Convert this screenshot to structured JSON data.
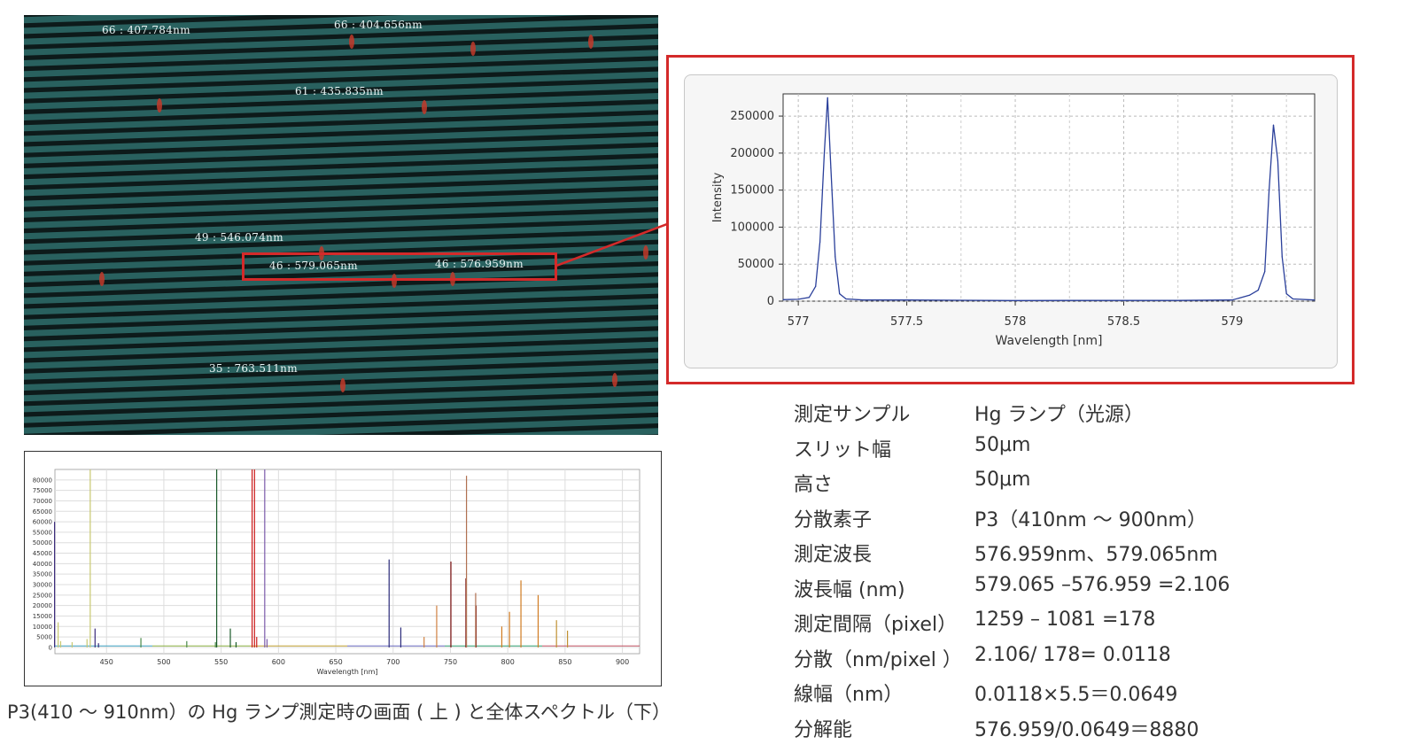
{
  "echelle_image": {
    "labels": [
      "66 : 407.784nm",
      "66 : 404.656nm",
      "61 : 435.835nm",
      "49 : 546.074nm",
      "46 : 579.065nm",
      "46 : 576.959nm",
      "35 : 763.511nm"
    ]
  },
  "caption": "P3(410 〜 910nm）の Hg ランプ測定時の画面 ( 上 ) と全体スペクトル（下）",
  "specs": [
    {
      "label": "測定サンプル",
      "value": "Hg ランプ（光源）"
    },
    {
      "label": "スリット幅",
      "value": "50μm"
    },
    {
      "label": "高さ",
      "value": "50μm"
    },
    {
      "label": "分散素子",
      "value": "P3（410nm 〜 900nm）"
    },
    {
      "label": "測定波長",
      "value": "576.959nm、579.065nm"
    },
    {
      "label": "波長幅 (nm)",
      "value": "579.065 –576.959 =2.106"
    },
    {
      "label": "測定間隔（pixel）",
      "value": "1259 – 1081 =178"
    },
    {
      "label": "分散（nm/pixel ）",
      "value": "2.106/ 178= 0.0118"
    },
    {
      "label": "線幅（nm）",
      "value": "0.0118×5.5＝0.0649"
    },
    {
      "label": "分解能",
      "value": "576.959/0.0649＝8880"
    }
  ],
  "chart_data": [
    {
      "type": "line",
      "xlabel": "Wavelength [nm]",
      "ylabel": "Intensity",
      "xlim": [
        576.93,
        579.38
      ],
      "ylim": [
        0,
        280000
      ],
      "x_ticks": [
        "577",
        "577.5",
        "578",
        "578.5",
        "579"
      ],
      "y_ticks": [
        "0",
        "50000",
        "100000",
        "150000",
        "200000",
        "250000"
      ],
      "grid": true,
      "series": [
        {
          "color": "#2a3f9a",
          "points": [
            [
              576.93,
              2000
            ],
            [
              577.0,
              2500
            ],
            [
              577.05,
              5000
            ],
            [
              577.08,
              20000
            ],
            [
              577.1,
              80000
            ],
            [
              577.12,
              200000
            ],
            [
              577.135,
              275000
            ],
            [
              577.15,
              180000
            ],
            [
              577.17,
              60000
            ],
            [
              577.19,
              10000
            ],
            [
              577.22,
              3000
            ],
            [
              577.3,
              1500
            ],
            [
              577.5,
              1500
            ],
            [
              577.75,
              1200
            ],
            [
              578.0,
              800
            ],
            [
              578.25,
              900
            ],
            [
              578.5,
              900
            ],
            [
              578.75,
              900
            ],
            [
              579.0,
              1500
            ],
            [
              579.08,
              8000
            ],
            [
              579.12,
              15000
            ],
            [
              579.15,
              40000
            ],
            [
              579.17,
              150000
            ],
            [
              579.19,
              238000
            ],
            [
              579.21,
              190000
            ],
            [
              579.23,
              60000
            ],
            [
              579.25,
              10000
            ],
            [
              579.28,
              3000
            ],
            [
              579.38,
              1500
            ]
          ]
        }
      ]
    },
    {
      "type": "line",
      "xlabel": "Wavelength [nm]",
      "ylabel": "",
      "xlim": [
        405,
        915
      ],
      "ylim": [
        -3000,
        85000
      ],
      "x_ticks": [
        "450",
        "500",
        "550",
        "600",
        "650",
        "700",
        "750",
        "800",
        "850",
        "900"
      ],
      "y_ticks": [
        "0",
        "5000",
        "10000",
        "15000",
        "20000",
        "25000",
        "30000",
        "35000",
        "40000",
        "45000",
        "50000",
        "55000",
        "60000",
        "65000",
        "70000",
        "75000",
        "80000"
      ],
      "grid": true,
      "series": [
        {
          "name": "",
          "color": "#c8c870",
          "peaks": [
            [
              407.8,
              12000
            ],
            [
              410,
              3000
            ],
            [
              420,
              2500
            ],
            [
              433,
              4000
            ],
            [
              435.8,
              85000
            ]
          ]
        },
        {
          "name": "",
          "color": "#3a2a7a",
          "peaks": [
            [
              404.7,
              60000
            ],
            [
              440,
              9000
            ],
            [
              443,
              2000
            ]
          ]
        },
        {
          "name": "",
          "color": "#4a8a4a",
          "peaks": [
            [
              480,
              4500
            ],
            [
              520,
              3000
            ],
            [
              545,
              2500
            ]
          ]
        },
        {
          "name": "",
          "color": "#1a5a2a",
          "peaks": [
            [
              546.1,
              85000
            ],
            [
              558,
              9000
            ],
            [
              563,
              2500
            ]
          ]
        },
        {
          "name": "",
          "color": "#cc1a1a",
          "peaks": [
            [
              577.0,
              85000
            ],
            [
              579.1,
              85000
            ],
            [
              581,
              5000
            ]
          ]
        },
        {
          "name": "",
          "color": "#7a5aaa",
          "peaks": [
            [
              588,
              85000
            ],
            [
              590,
              4000
            ]
          ]
        },
        {
          "name": "",
          "color": "#2a2a7a",
          "peaks": [
            [
              696.5,
              42000
            ],
            [
              706.7,
              9500
            ]
          ]
        },
        {
          "name": "",
          "color": "#d08040",
          "peaks": [
            [
              727,
              5000
            ],
            [
              738,
              20000
            ]
          ]
        },
        {
          "name": "",
          "color": "#7a1010",
          "peaks": [
            [
              750.4,
              41000
            ],
            [
              763.5,
              33000
            ],
            [
              772.4,
              20000
            ]
          ]
        },
        {
          "name": "",
          "color": "#b07050",
          "peaks": [
            [
              764,
              82000
            ],
            [
              772,
              26000
            ]
          ]
        },
        {
          "name": "",
          "color": "#d07a20",
          "peaks": [
            [
              794.8,
              10000
            ],
            [
              801.5,
              17000
            ],
            [
              811.5,
              32000
            ],
            [
              826.5,
              25000
            ]
          ]
        },
        {
          "name": "",
          "color": "#c09030",
          "peaks": [
            [
              842.5,
              13000
            ],
            [
              852.1,
              8000
            ]
          ]
        }
      ]
    }
  ]
}
